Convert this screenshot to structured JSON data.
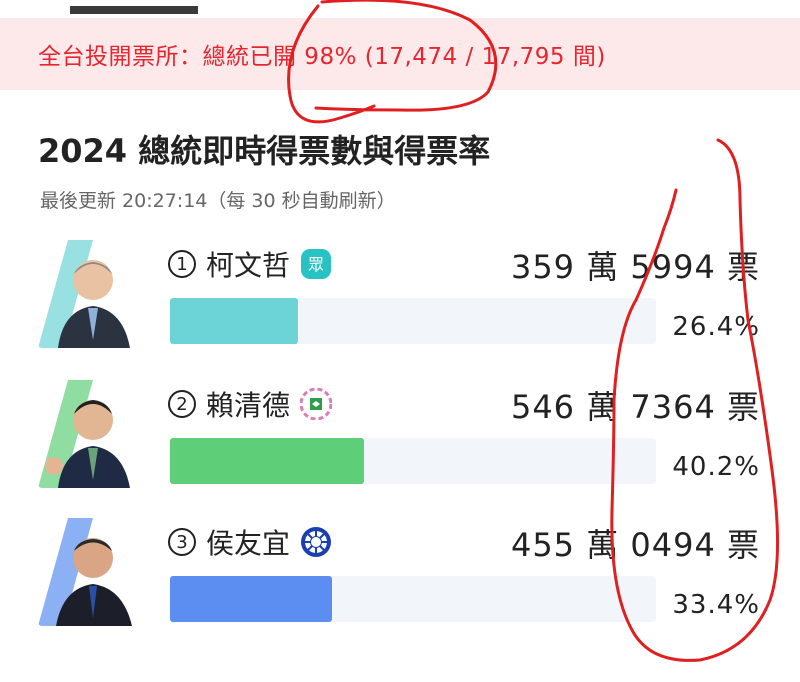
{
  "banner": {
    "text": "全台投開票所：總統已開 98% (17,474 / 17,795 間)"
  },
  "title": "2024 總統即時得票數與得票率",
  "updated": "最後更新 20:27:14（每 30 秒自動刷新）",
  "colors": {
    "banner_bg": "#fde8ea",
    "banner_text": "#e5262f",
    "track": "#f2f5f9",
    "annotation": "#e02020"
  },
  "candidates": [
    {
      "number": "1",
      "name": "柯文哲",
      "party_icon": "tpp-party-icon",
      "votes": "359 萬 5994 票",
      "percent": "26.4%",
      "share": 0.264,
      "color": "#6cd3d6"
    },
    {
      "number": "2",
      "name": "賴清德",
      "party_icon": "dpp-party-icon",
      "votes": "546 萬 7364 票",
      "percent": "40.2%",
      "share": 0.402,
      "color": "#5fce78"
    },
    {
      "number": "3",
      "name": "侯友宜",
      "party_icon": "kmt-party-icon",
      "votes": "455 萬 0494 票",
      "percent": "33.4%",
      "share": 0.334,
      "color": "#5b8ef0"
    }
  ]
}
